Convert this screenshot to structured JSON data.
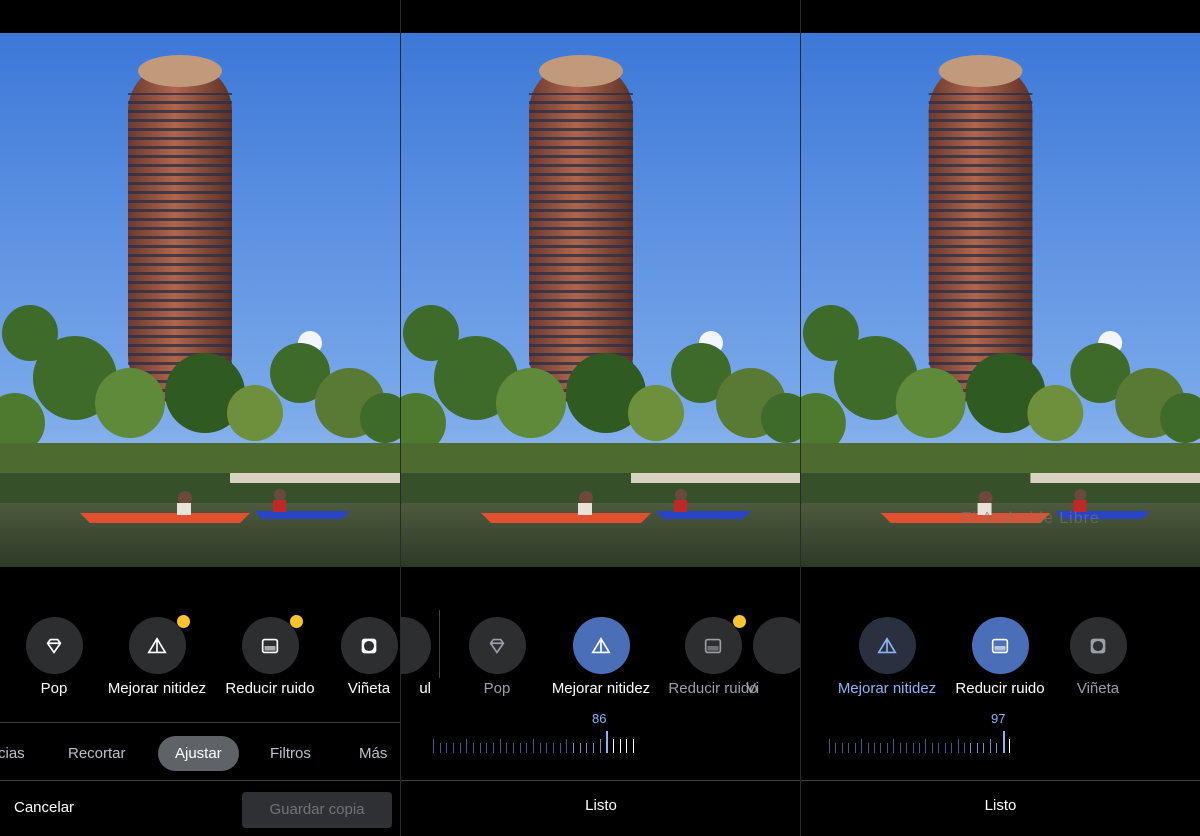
{
  "colors": {
    "accent": "#4a6fb8",
    "accent_text": "#8ab4f8",
    "badge": "#f9c52c",
    "chip": "#2d2e30"
  },
  "panel1": {
    "tools": [
      {
        "label": "Pop",
        "icon": "diamond-icon"
      },
      {
        "label": "Mejorar nitidez",
        "icon": "triangle-icon",
        "badge": true
      },
      {
        "label": "Reducir ruido",
        "icon": "noise-square-icon",
        "badge": true
      },
      {
        "label": "Viñeta",
        "icon": "vignette-icon"
      }
    ],
    "tabs": [
      "cias",
      "Recortar",
      "Ajustar",
      "Filtros",
      "Más"
    ],
    "active_tab": "Ajustar",
    "cancel_label": "Cancelar",
    "save_label": "Guardar copia"
  },
  "panel2": {
    "partial_left_label": "ul",
    "tools": [
      {
        "label": "Pop",
        "icon": "diamond-icon"
      },
      {
        "label": "Mejorar nitidez",
        "icon": "triangle-icon",
        "active": true
      },
      {
        "label": "Reducir ruido",
        "icon": "noise-square-icon",
        "badge": true
      },
      {
        "label": "Vi",
        "icon": "vignette-icon"
      }
    ],
    "slider_value": "86",
    "done_label": "Listo"
  },
  "panel3": {
    "tools": [
      {
        "label": "Mejorar nitidez",
        "icon": "triangle-icon"
      },
      {
        "label": "Reducir ruido",
        "icon": "noise-square-icon",
        "active": true
      },
      {
        "label": "Viñeta",
        "icon": "vignette-icon"
      }
    ],
    "slider_value": "97",
    "done_label": "Listo",
    "watermark": "El Androide Libre"
  }
}
